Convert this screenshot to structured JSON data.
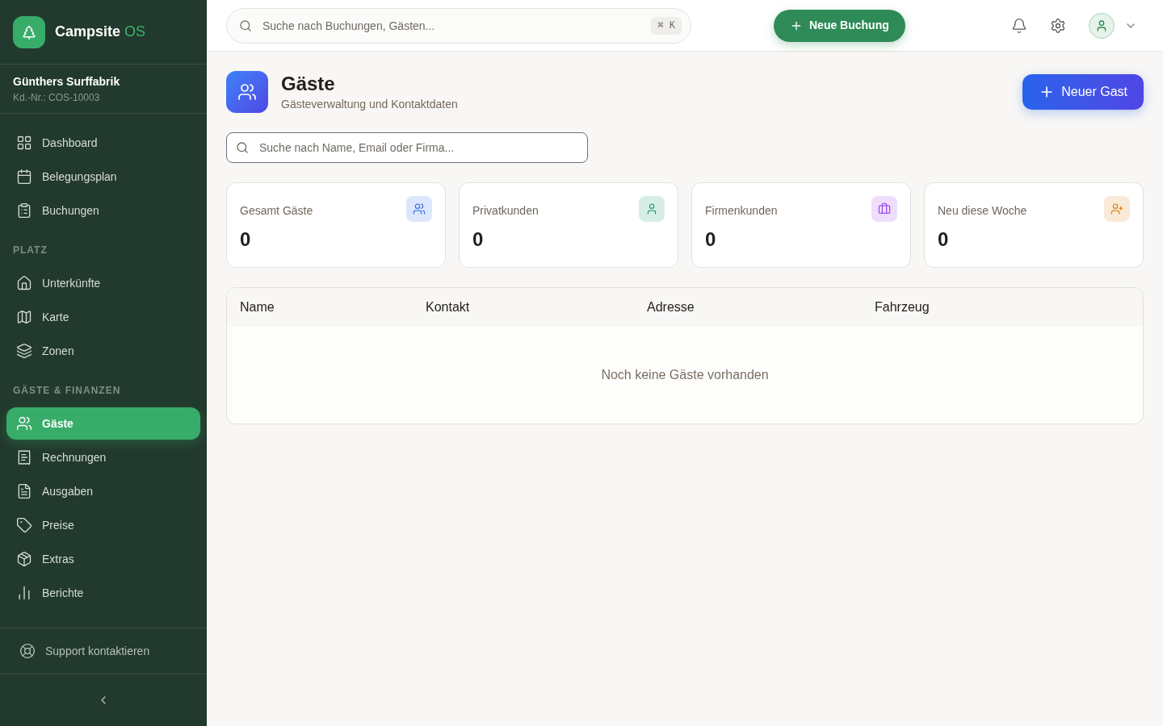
{
  "brand": {
    "name": "Campsite",
    "suffix": "OS"
  },
  "account": {
    "name": "Günthers Surffabrik",
    "number": "Kd.-Nr.: COS-10003"
  },
  "sidebar": {
    "sections": [
      {
        "items": [
          {
            "label": "Dashboard",
            "selected": false
          },
          {
            "label": "Belegungsplan",
            "selected": false
          },
          {
            "label": "Buchungen",
            "selected": false
          }
        ]
      },
      {
        "title": "PLATZ",
        "items": [
          {
            "label": "Unterkünfte",
            "selected": false
          },
          {
            "label": "Karte",
            "selected": false
          },
          {
            "label": "Zonen",
            "selected": false
          }
        ]
      },
      {
        "title": "GÄSTE & FINANZEN",
        "items": [
          {
            "label": "Gäste",
            "selected": true
          },
          {
            "label": "Rechnungen",
            "selected": false
          },
          {
            "label": "Ausgaben",
            "selected": false
          },
          {
            "label": "Preise",
            "selected": false
          },
          {
            "label": "Extras",
            "selected": false
          },
          {
            "label": "Berichte",
            "selected": false
          }
        ]
      }
    ],
    "support": "Support kontaktieren"
  },
  "topbar": {
    "search": {
      "placeholder": "Suche nach Buchungen, Gästen...",
      "shortcut": "⌘ K"
    },
    "new_booking": "Neue Buchung"
  },
  "page": {
    "title": "Gäste",
    "subtitle": "Gästeverwaltung und Kontaktdaten",
    "new_button": "Neuer Gast",
    "search": {
      "placeholder": "Suche nach Name, Email oder Firma..."
    }
  },
  "stats": [
    {
      "label": "Gesamt Gäste",
      "value": "0",
      "color": "#2563eb"
    },
    {
      "label": "Privatkunden",
      "value": "0",
      "color": "#059669"
    },
    {
      "label": "Firmenkunden",
      "value": "0",
      "color": "#9333ea"
    },
    {
      "label": "Neu diese Woche",
      "value": "0",
      "color": "#d97706"
    }
  ],
  "table": {
    "columns": [
      "Name",
      "Kontakt",
      "Adresse",
      "Fahrzeug"
    ],
    "empty": "Noch keine Gäste vorhanden"
  }
}
